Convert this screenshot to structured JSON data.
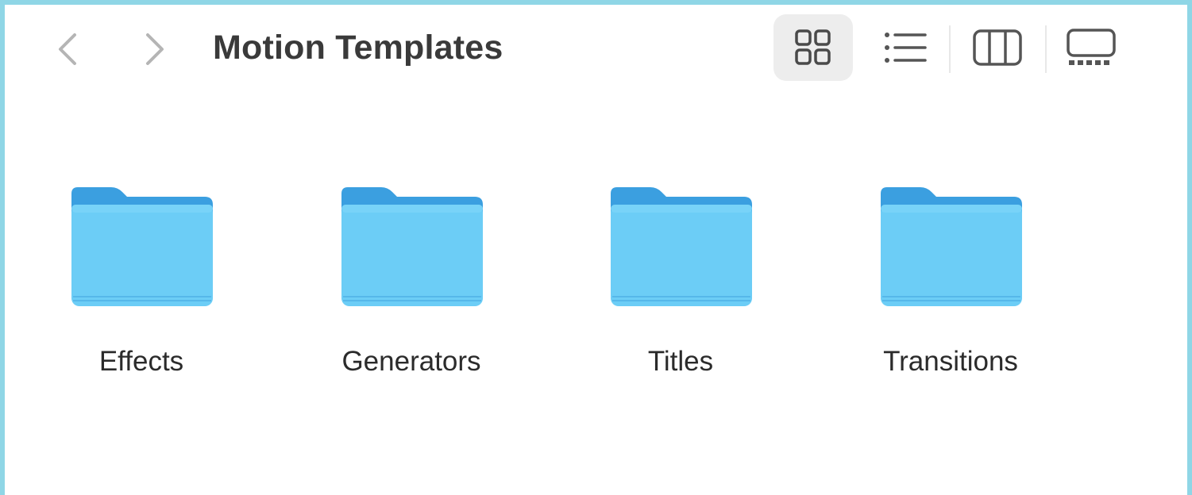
{
  "window": {
    "title": "Motion Templates"
  },
  "toolbar": {
    "back_icon": "chevron-left-icon",
    "forward_icon": "chevron-right-icon",
    "views": [
      {
        "name": "icons",
        "icon": "grid-icon",
        "selected": true
      },
      {
        "name": "list",
        "icon": "list-icon",
        "selected": false
      },
      {
        "name": "columns",
        "icon": "columns-icon",
        "selected": false
      },
      {
        "name": "gallery",
        "icon": "gallery-icon",
        "selected": false
      }
    ]
  },
  "folders": [
    {
      "name": "Effects",
      "icon": "folder-icon"
    },
    {
      "name": "Generators",
      "icon": "folder-icon"
    },
    {
      "name": "Titles",
      "icon": "folder-icon"
    },
    {
      "name": "Transitions",
      "icon": "folder-icon"
    }
  ],
  "colors": {
    "frame": "#8fd6e6",
    "folder_back": "#3b9fe0",
    "folder_front": "#6ccdf6",
    "selected_view_bg": "#ededed"
  }
}
